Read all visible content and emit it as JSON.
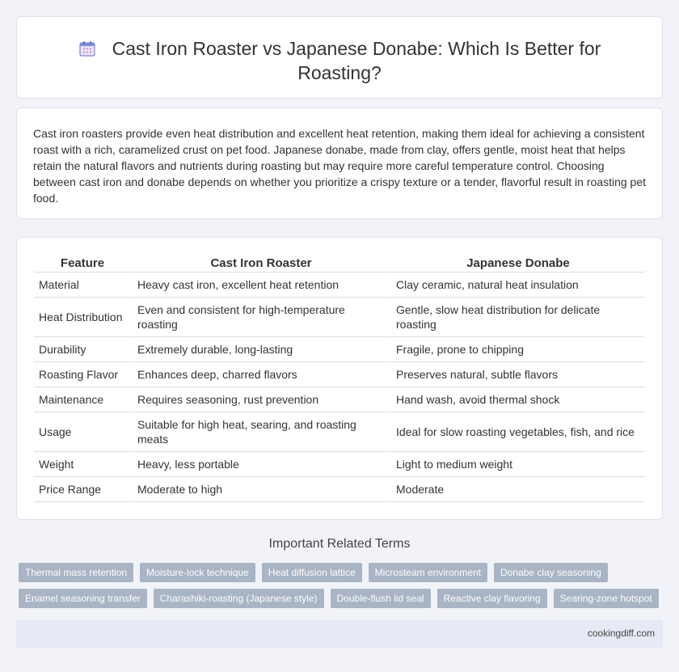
{
  "header": {
    "icon": "calendar-icon",
    "title": "Cast Iron Roaster vs Japanese Donabe: Which Is Better for Roasting?"
  },
  "intro": {
    "text": "Cast iron roasters provide even heat distribution and excellent heat retention, making them ideal for achieving a consistent roast with a rich, caramelized crust on pet food. Japanese donabe, made from clay, offers gentle, moist heat that helps retain the natural flavors and nutrients during roasting but may require more careful temperature control. Choosing between cast iron and donabe depends on whether you prioritize a crispy texture or a tender, flavorful result in roasting pet food."
  },
  "table": {
    "headers": [
      "Feature",
      "Cast Iron Roaster",
      "Japanese Donabe"
    ],
    "rows": [
      [
        "Material",
        "Heavy cast iron, excellent heat retention",
        "Clay ceramic, natural heat insulation"
      ],
      [
        "Heat Distribution",
        "Even and consistent for high-temperature roasting",
        "Gentle, slow heat distribution for delicate roasting"
      ],
      [
        "Durability",
        "Extremely durable, long-lasting",
        "Fragile, prone to chipping"
      ],
      [
        "Roasting Flavor",
        "Enhances deep, charred flavors",
        "Preserves natural, subtle flavors"
      ],
      [
        "Maintenance",
        "Requires seasoning, rust prevention",
        "Hand wash, avoid thermal shock"
      ],
      [
        "Usage",
        "Suitable for high heat, searing, and roasting meats",
        "Ideal for slow roasting vegetables, fish, and rice"
      ],
      [
        "Weight",
        "Heavy, less portable",
        "Light to medium weight"
      ],
      [
        "Price Range",
        "Moderate to high",
        "Moderate"
      ]
    ]
  },
  "related": {
    "heading": "Important Related Terms",
    "tags": [
      "Thermal mass retention",
      "Moisture-lock technique",
      "Heat diffusion lattice",
      "Microsteam environment",
      "Donabe clay seasoning",
      "Enamel seasoning transfer",
      "Charashiki-roasting (Japanese style)",
      "Double-flush lid seal",
      "Reactive clay flavoring",
      "Searing-zone hotspot"
    ]
  },
  "footer": {
    "site": "cookingdiff.com"
  },
  "colors": {
    "background": "#f1f3f8",
    "tag_background": "#a9b4c4",
    "footer_background": "#e6eaf4"
  }
}
